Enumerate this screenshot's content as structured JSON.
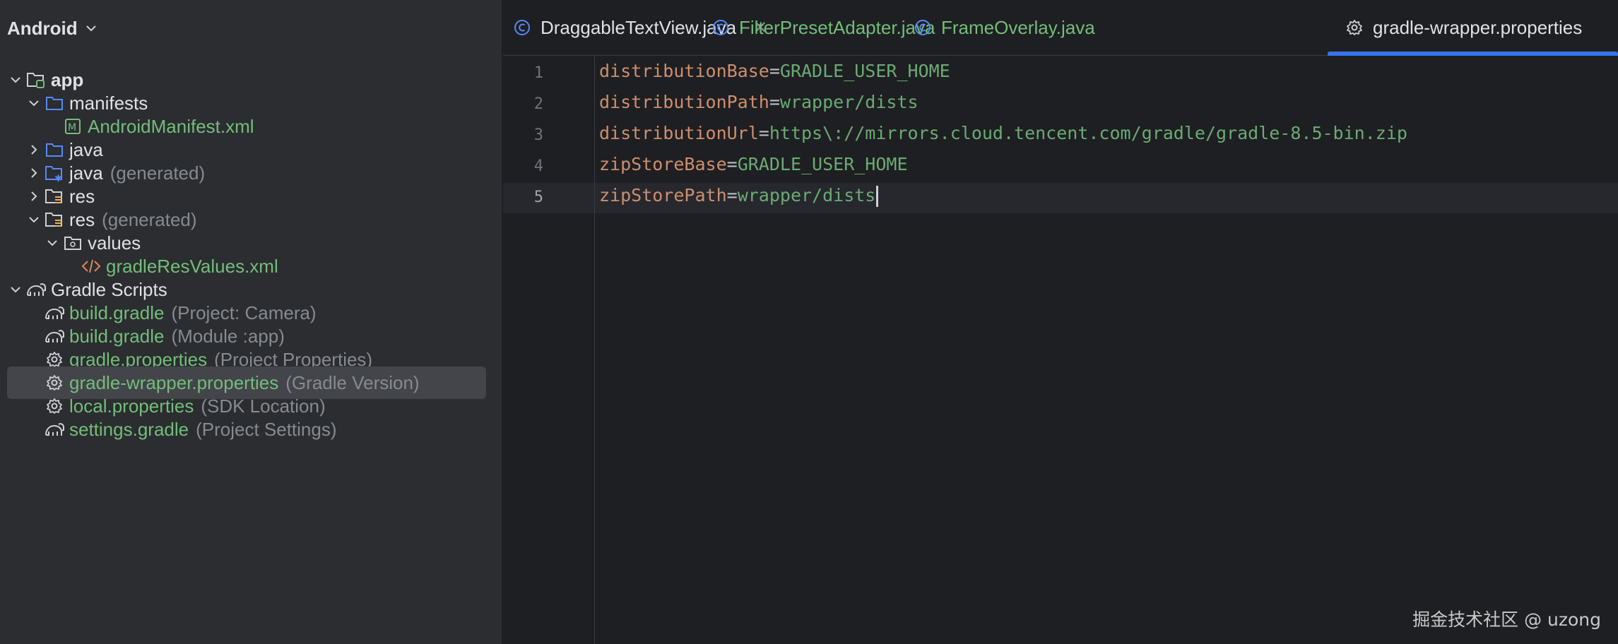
{
  "project_panel": {
    "title": "Android",
    "tree": [
      {
        "label": "app",
        "hint": "",
        "icon": "module-folder-icon",
        "chevron": "down",
        "color": "white",
        "bold": true
      },
      {
        "label": "manifests",
        "hint": "",
        "icon": "folder-icon",
        "chevron": "down",
        "color": "white"
      },
      {
        "label": "AndroidManifest.xml",
        "hint": "",
        "icon": "manifest-file-icon",
        "chevron": "",
        "color": "green"
      },
      {
        "label": "java",
        "hint": "",
        "icon": "folder-icon",
        "chevron": "right",
        "color": "white"
      },
      {
        "label": "java",
        "hint": "(generated)",
        "icon": "generated-source-folder-icon",
        "chevron": "right",
        "color": "white"
      },
      {
        "label": "res",
        "hint": "",
        "icon": "resource-folder-icon",
        "chevron": "right",
        "color": "white"
      },
      {
        "label": "res",
        "hint": "(generated)",
        "icon": "resource-folder-icon",
        "chevron": "down",
        "color": "white"
      },
      {
        "label": "values",
        "hint": "",
        "icon": "values-folder-icon",
        "chevron": "down",
        "color": "white"
      },
      {
        "label": "gradleResValues.xml",
        "hint": "",
        "icon": "xml-file-icon",
        "chevron": "",
        "color": "green"
      },
      {
        "label": "Gradle Scripts",
        "hint": "",
        "icon": "gradle-elephant-icon",
        "chevron": "down",
        "color": "white"
      },
      {
        "label": "build.gradle",
        "hint": "(Project: Camera)",
        "icon": "gradle-elephant-icon",
        "chevron": "",
        "color": "green"
      },
      {
        "label": "build.gradle",
        "hint": "(Module :app)",
        "icon": "gradle-elephant-icon",
        "chevron": "",
        "color": "green"
      },
      {
        "label": "gradle.properties",
        "hint": "(Project Properties)",
        "icon": "gear-icon",
        "chevron": "",
        "color": "green"
      },
      {
        "label": "gradle-wrapper.properties",
        "hint": "(Gradle Version)",
        "icon": "gear-icon",
        "chevron": "",
        "color": "green",
        "selected": true
      },
      {
        "label": "local.properties",
        "hint": "(SDK Location)",
        "icon": "gear-icon",
        "chevron": "",
        "color": "green"
      },
      {
        "label": "settings.gradle",
        "hint": "(Project Settings)",
        "icon": "gradle-elephant-icon",
        "chevron": "",
        "color": "green"
      }
    ]
  },
  "editor": {
    "tabs": [
      {
        "label": "DraggableTextView.java",
        "icon": "java-class-icon",
        "closable": true,
        "modified": false
      },
      {
        "label": "FilterPresetAdapter.java",
        "icon": "java-class-icon",
        "closable": false,
        "modified": true
      },
      {
        "label": "FrameOverlay.java",
        "icon": "java-class-icon",
        "closable": false,
        "modified": true
      },
      {
        "label": "gradle-wrapper.properties",
        "icon": "gear-icon",
        "closable": false,
        "modified": false,
        "active": true
      }
    ],
    "lines": [
      {
        "number": "1",
        "key": "distributionBase",
        "value": "GRADLE_USER_HOME"
      },
      {
        "number": "2",
        "key": "distributionPath",
        "value": "wrapper/dists"
      },
      {
        "number": "3",
        "key": "distributionUrl",
        "value": "https\\://mirrors.cloud.tencent.com/gradle/gradle-8.5-bin.zip"
      },
      {
        "number": "4",
        "key": "zipStoreBase",
        "value": "GRADLE_USER_HOME"
      },
      {
        "number": "5",
        "key": "zipStorePath",
        "value": "wrapper/dists"
      }
    ],
    "current_line": "5"
  },
  "watermark": "掘金技术社区 @ uzong",
  "colors": {
    "accent": "#3574f0",
    "key": "#cf8e6d",
    "value": "#6aab73",
    "modified_file": "#73bd79"
  }
}
